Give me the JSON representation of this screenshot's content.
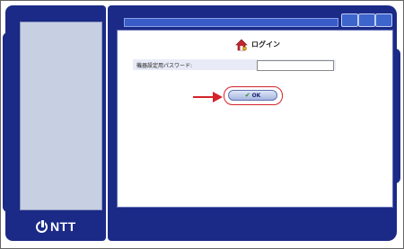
{
  "brand": {
    "name": "NTT"
  },
  "login": {
    "title": "ログイン",
    "password_label": "機器設定用パスワード:",
    "password_value": "",
    "ok_label": "OK"
  },
  "icons": {
    "login": "house-key-icon",
    "ok": "checkmark-icon",
    "pointer": "red-arrow-icon",
    "logo": "ntt-logo-icon"
  },
  "colors": {
    "panel": "#1b2a86",
    "accent": "#d4232b",
    "titlebar": "#3a5cc8"
  }
}
